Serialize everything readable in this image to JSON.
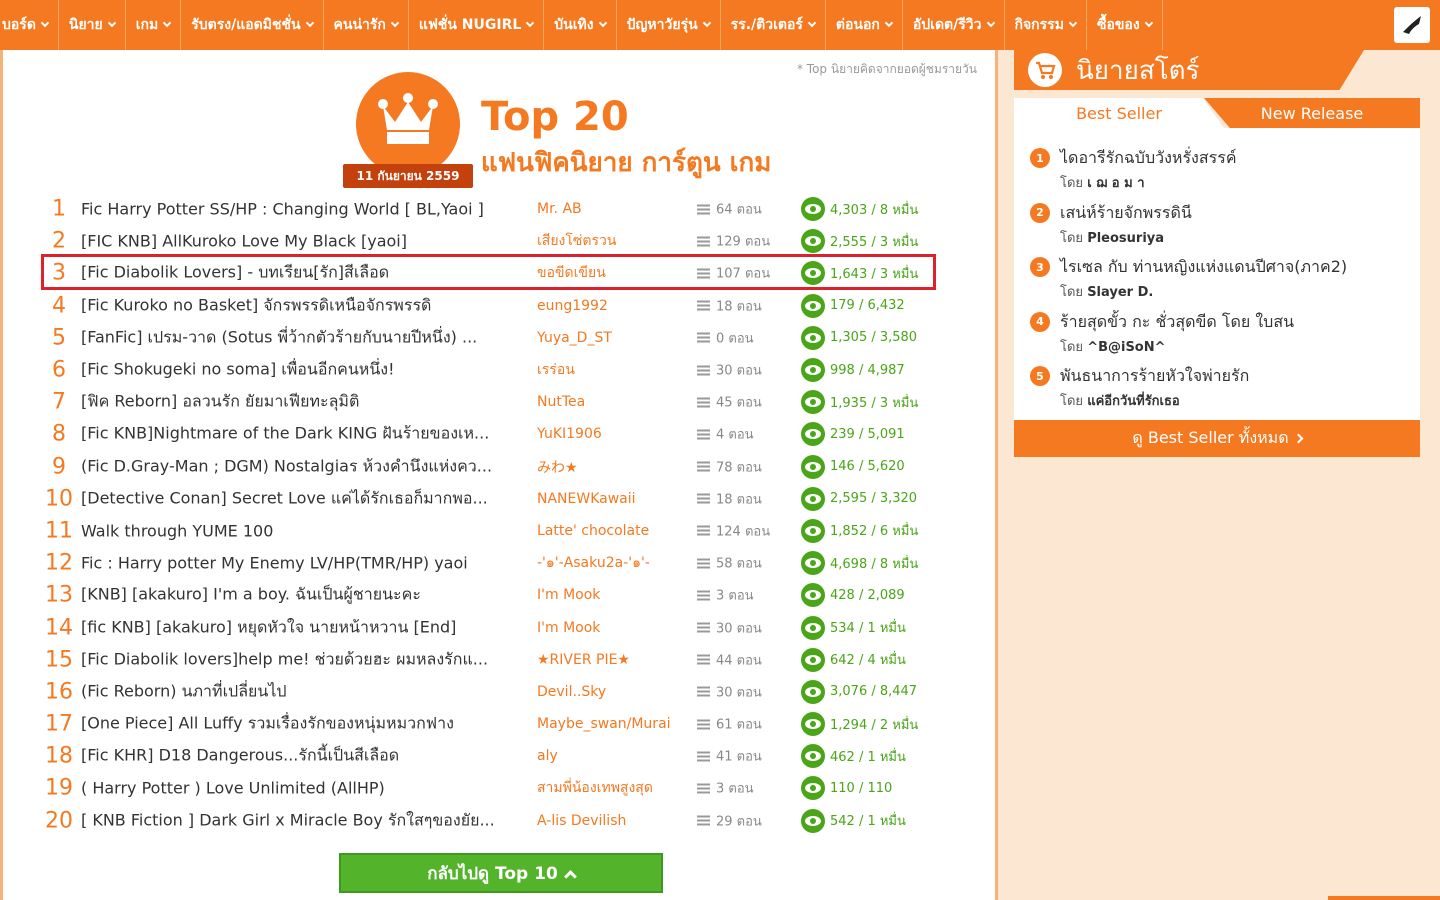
{
  "nav": {
    "items": [
      "บอร์ด",
      "นิยาย",
      "เกม",
      "รับตรง/แอดมิชชั่น",
      "คนน่ารัก",
      "แฟชั่น NUGIRL",
      "บันเทิง",
      "ปัญหาวัยรุ่น",
      "รร./ติวเตอร์",
      "ต่อนอก",
      "อัปเดต/รีวิว",
      "กิจกรรม",
      "ซื้อของ"
    ]
  },
  "header": {
    "note": "* Top นิยายคิดจากยอดผู้ชมรายวัน",
    "date": "11 กันยายน 2559",
    "title": "Top 20",
    "subtitle": "แฟนฟิคนิยาย การ์ตูน เกม"
  },
  "rankings": [
    {
      "rank": "1",
      "title": "Fic Harry Potter SS/HP : Changing World [ BL,Yaoi ]",
      "author": "Mr. AB",
      "chapters": "64 ตอน",
      "views": "4,303 / 8 หมื่น"
    },
    {
      "rank": "2",
      "title": "[FIC KNB] AllKuroko Love My Black [yaoi]",
      "author": "เสียงโซ่ตรวน",
      "chapters": "129 ตอน",
      "views": "2,555 / 3 หมื่น"
    },
    {
      "rank": "3",
      "title": "[Fic Diabolik Lovers] - บทเรียน[รัก]สีเลือด",
      "author": "ขอขีดเขียน",
      "chapters": "107 ตอน",
      "views": "1,643 / 3 หมื่น"
    },
    {
      "rank": "4",
      "title": "[Fic Kuroko no Basket] จักรพรรดิเหนือจักรพรรดิ",
      "author": "eung1992",
      "chapters": "18 ตอน",
      "views": "179 / 6,432"
    },
    {
      "rank": "5",
      "title": "[FanFic] เปรม-วาด (Sotus พี่ว้ากตัวร้ายกับนายปีหนึ่ง) ...",
      "author": "Yuya_D_ST",
      "chapters": "0 ตอน",
      "views": "1,305 / 3,580"
    },
    {
      "rank": "6",
      "title": "[Fic Shokugeki no soma] เพื่อนอีกคนหนึ่ง!",
      "author": "เรร่อน",
      "chapters": "30 ตอน",
      "views": "998 / 4,987"
    },
    {
      "rank": "7",
      "title": "[ฟิค Reborn] อลวนรัก ยัยมาเฟียทะลุมิติ",
      "author": "NutTea",
      "chapters": "45 ตอน",
      "views": "1,935 / 3 หมื่น"
    },
    {
      "rank": "8",
      "title": "[Fic KNB]Nightmare of the Dark KING ฝันร้ายของเห...",
      "author": "YuKI1906",
      "chapters": "4 ตอน",
      "views": "239 / 5,091"
    },
    {
      "rank": "9",
      "title": "(Fic D.Gray-Man ; DGM) Nostalgiaร ห้วงคำนึงแห่งคว...",
      "author": "みわ★",
      "chapters": "78 ตอน",
      "views": "146 / 5,620"
    },
    {
      "rank": "10",
      "title": "[Detective Conan] Secret Love แค่ได้รักเธอก็มากพอ...",
      "author": "NANEWKawaii",
      "chapters": "18 ตอน",
      "views": "2,595 / 3,320"
    },
    {
      "rank": "11",
      "title": "Walk through YUME 100",
      "author": "Latte' chocolate",
      "chapters": "124 ตอน",
      "views": "1,852 / 6 หมื่น"
    },
    {
      "rank": "12",
      "title": "Fic : Harry potter My Enemy LV/HP(TMR/HP) yaoi",
      "author": "-'๑'-Asaku2a-'๑'-",
      "chapters": "58 ตอน",
      "views": "4,698 / 8 หมื่น"
    },
    {
      "rank": "13",
      "title": "[KNB] [akakuro] I'm a boy. ฉันเป็นผู้ชายนะคะ",
      "author": "I'm Mook",
      "chapters": "3 ตอน",
      "views": "428 / 2,089"
    },
    {
      "rank": "14",
      "title": "[fic KNB] [akakuro] หยุดหัวใจ นายหน้าหวาน [End]",
      "author": "I'm Mook",
      "chapters": "30 ตอน",
      "views": "534 / 1 หมื่น"
    },
    {
      "rank": "15",
      "title": "[Fic Diabolik lovers]help me! ช่วยด้วยฮะ ผมหลงรักแ...",
      "author": "★RIVER PIE★",
      "chapters": "44 ตอน",
      "views": "642 / 4 หมื่น"
    },
    {
      "rank": "16",
      "title": "(Fic Reborn) นภาที่เปลี่ยนไป",
      "author": "Devil..Sky",
      "chapters": "30 ตอน",
      "views": "3,076 / 8,447"
    },
    {
      "rank": "17",
      "title": "[One Piece] All Luffy รวมเรื่องรักของหนุ่มหมวกฟาง",
      "author": "Maybe_swan/Murai",
      "chapters": "61 ตอน",
      "views": "1,294 / 2 หมื่น"
    },
    {
      "rank": "18",
      "title": "[Fic KHR] D18 Dangerous...รักนี้เป็นสีเลือด",
      "author": "aly",
      "chapters": "41 ตอน",
      "views": "462 / 1 หมื่น"
    },
    {
      "rank": "19",
      "title": "( Harry Potter ) Love Unlimited (AllHP)",
      "author": "สามพี่น้องเทพสูงสุด",
      "chapters": "3 ตอน",
      "views": "110 / 110"
    },
    {
      "rank": "20",
      "title": "[ KNB Fiction ] Dark Girl x Miracle Boy รักใสๆของยัย...",
      "author": "A-lis Devilish",
      "chapters": "29 ตอน",
      "views": "542 / 1 หมื่น"
    }
  ],
  "back_button": "กลับไปดู Top 10",
  "sidebar": {
    "title": "นิยายสโตร์",
    "tabs": [
      "Best Seller",
      "New Release"
    ],
    "best_sellers": [
      {
        "num": "1",
        "title": "ไดอารีรักฉบับวังหรั่งสรรค์",
        "author_prefix": "โดย",
        "author": "เ ฌ อ ม า"
      },
      {
        "num": "2",
        "title": "เสน่ห์ร้ายจักพรรดินี",
        "author_prefix": "โดย",
        "author": "Pleosuriya"
      },
      {
        "num": "3",
        "title": "ไรเซล กับ ท่านหญิงแห่งแดนปีศาจ(ภาค2)",
        "author_prefix": "โดย",
        "author": "Slayer D."
      },
      {
        "num": "4",
        "title": "ร้ายสุดขั้ว กะ ชั่วสุดขีด โดย ใบสน",
        "author_prefix": "โดย",
        "author": "^B@iSoN^"
      },
      {
        "num": "5",
        "title": "พันธนาการร้ายหัวใจพ่ายรัก",
        "author_prefix": "โดย",
        "author": "แค่อีกวันที่รักเธอ"
      }
    ],
    "see_all": "ดู Best Seller ทั้งหมด"
  },
  "colors": {
    "brand": "#f47920",
    "views": "#4aa518",
    "highlight": "#d9232d"
  }
}
